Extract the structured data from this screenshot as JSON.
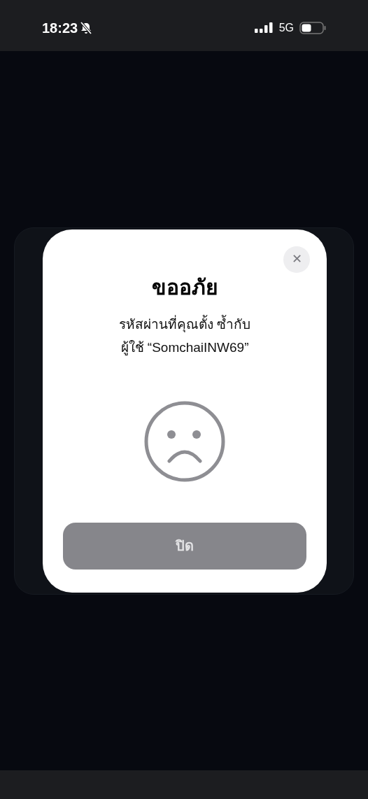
{
  "status_bar": {
    "time": "18:23",
    "network": "5G"
  },
  "dialog": {
    "title": "ขออภัย",
    "message_lines": [
      "รหัสผ่านที่คุณตั้ง ซ้ำกับ",
      "ผู้ใช้ “SomchaiINW69”"
    ],
    "close_label": "✕",
    "button": "ปิด"
  }
}
